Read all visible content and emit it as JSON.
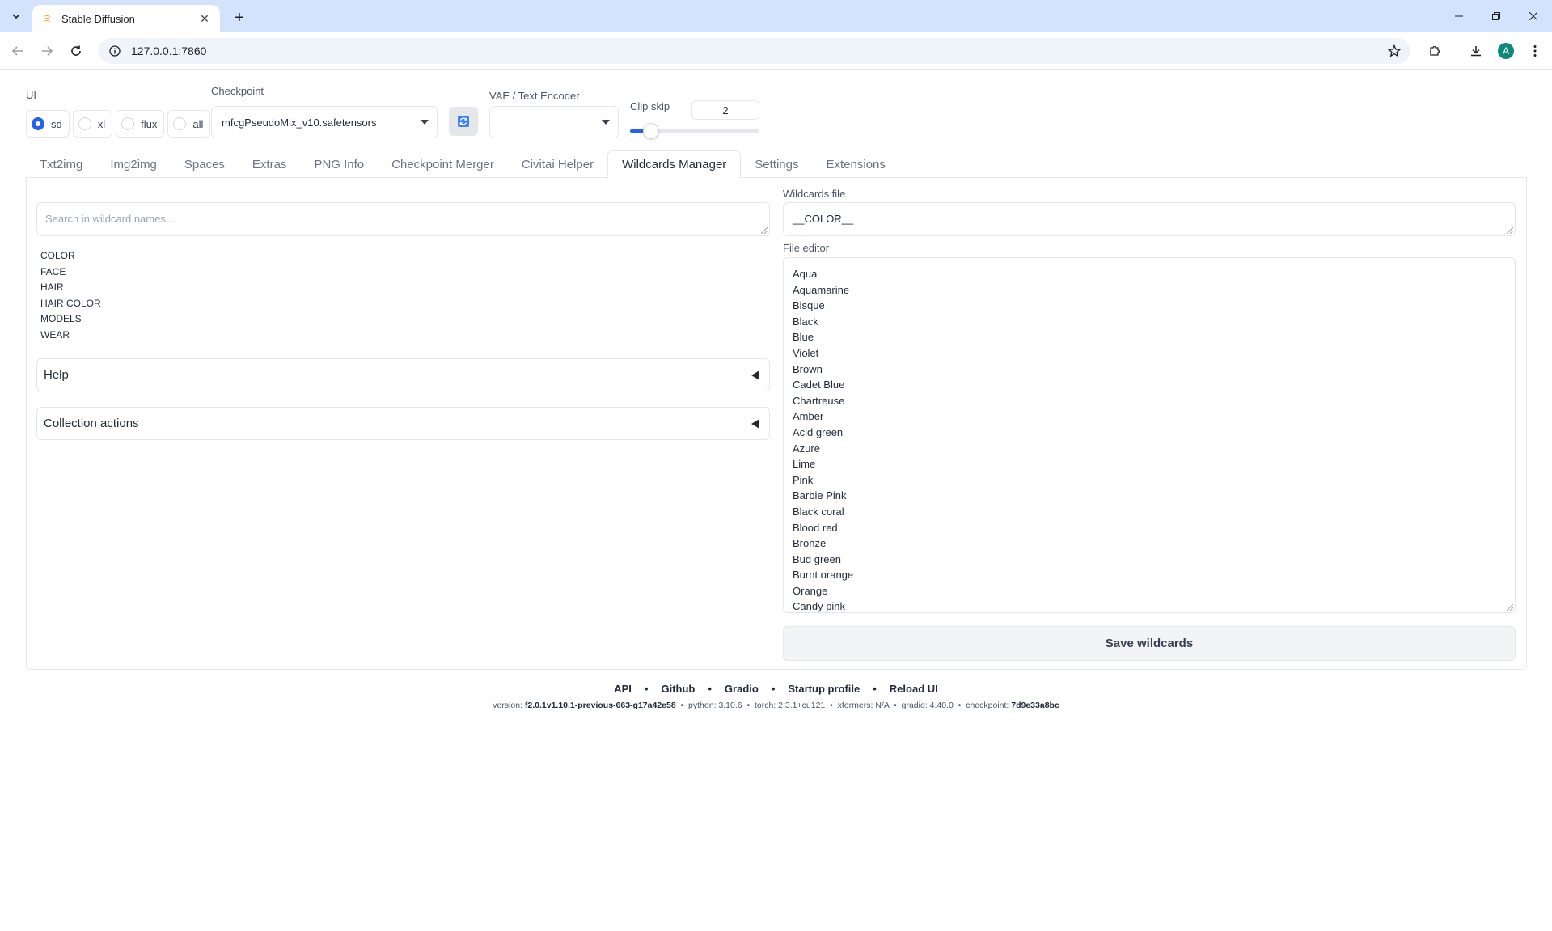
{
  "browser": {
    "tab_title": "Stable Diffusion",
    "url": "127.0.0.1:7860",
    "profile_initial": "A"
  },
  "top": {
    "ui_label": "UI",
    "ui_options": [
      "sd",
      "xl",
      "flux",
      "all"
    ],
    "ui_selected": "sd",
    "checkpoint_label": "Checkpoint",
    "checkpoint_value": "mfcgPseudoMix_v10.safetensors",
    "vae_label": "VAE / Text Encoder",
    "vae_value": "",
    "clip_skip_label": "Clip skip",
    "clip_skip_value": "2",
    "clip_skip_fraction": 0.1
  },
  "tabs": [
    "Txt2img",
    "Img2img",
    "Spaces",
    "Extras",
    "PNG Info",
    "Checkpoint Merger",
    "Civitai Helper",
    "Wildcards Manager",
    "Settings",
    "Extensions"
  ],
  "active_tab": "Wildcards Manager",
  "left": {
    "search_placeholder": "Search in wildcard names...",
    "wildcards": [
      "COLOR",
      "FACE",
      "HAIR",
      "HAIR COLOR",
      "MODELS",
      "WEAR"
    ],
    "help_label": "Help",
    "collection_label": "Collection actions"
  },
  "right": {
    "wildcards_file_label": "Wildcards file",
    "wildcards_file_value": "__COLOR__",
    "file_editor_label": "File editor",
    "file_lines": [
      "Aqua",
      "Aquamarine",
      "Bisque",
      "Black",
      "Blue",
      "Violet",
      "Brown",
      "Cadet Blue",
      "Chartreuse",
      "Amber",
      "Acid green",
      "Azure",
      "Lime",
      "Pink",
      "Barbie Pink",
      "Black coral",
      "Blood red",
      "Bronze",
      "Bud green",
      "Burnt orange",
      "Orange",
      "Candy pink"
    ],
    "save_label": "Save wildcards"
  },
  "footer": {
    "links": [
      "API",
      "Github",
      "Gradio",
      "Startup profile",
      "Reload UI"
    ],
    "version_label": "version:",
    "version": "f2.0.1v1.10.1-previous-663-g17a42e58",
    "python_label": "python:",
    "python": "3.10.6",
    "torch_label": "torch:",
    "torch": "2.3.1+cu121",
    "xformers_label": "xformers:",
    "xformers": "N/A",
    "gradio_label": "gradio:",
    "gradio": "4.40.0",
    "checkpoint_label": "checkpoint:",
    "checkpoint": "7d9e33a8bc"
  },
  "colors": {
    "accent": "#2563eb",
    "tabstrip": "#d3e3fd",
    "favicon": "#f5a623"
  }
}
